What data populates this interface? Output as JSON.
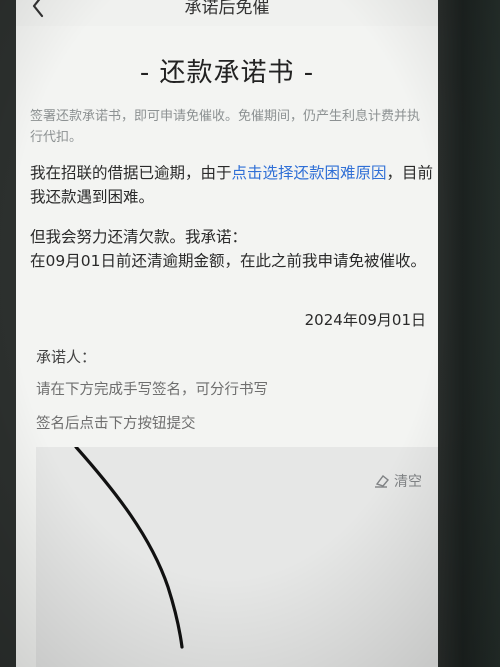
{
  "header": {
    "title": "承诺后免催"
  },
  "doc": {
    "title": "- 还款承诺书 -",
    "notice": "签署还款承诺书，即可申请免催收。免催期间，仍产生利息计费并执行代扣。",
    "para1_prefix": "我在招联的借据已逾期，由于",
    "para1_link": "点击选择还款困难原因",
    "para1_suffix": "，目前我还款遇到困难。",
    "para2_line1": "但我会努力还清欠款。我承诺：",
    "para2_line2": "在09月01日前还清逾期金额，在此之前我申请免被催收。",
    "date": "2024年09月01日"
  },
  "signature": {
    "signer_label": "承诺人：",
    "hint1": "请在下方完成手写签名，可分行书写",
    "hint2": "签名后点击下方按钮提交",
    "clear_label": "清空"
  },
  "icons": {
    "back": "chevron-left-icon",
    "clear": "eraser-icon"
  },
  "colors": {
    "link": "#2f6fd6",
    "notice": "#8c9192"
  }
}
